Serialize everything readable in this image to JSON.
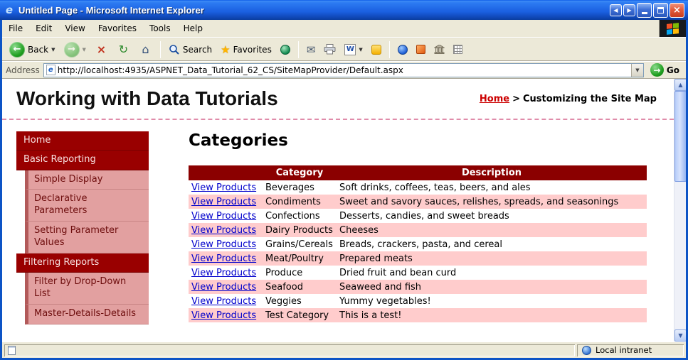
{
  "window": {
    "title": "Untitled Page - Microsoft Internet Explorer"
  },
  "menu": {
    "items": [
      {
        "label": "File"
      },
      {
        "label": "Edit"
      },
      {
        "label": "View"
      },
      {
        "label": "Favorites"
      },
      {
        "label": "Tools"
      },
      {
        "label": "Help"
      }
    ]
  },
  "toolbar": {
    "back_label": "Back",
    "search_label": "Search",
    "favorites_label": "Favorites"
  },
  "address": {
    "label": "Address",
    "value": "http://localhost:4935/ASPNET_Data_Tutorial_62_CS/SiteMapProvider/Default.aspx",
    "go_label": "Go"
  },
  "page": {
    "title": "Working with Data Tutorials",
    "breadcrumb": {
      "home_label": "Home",
      "separator": ">",
      "current": "Customizing the Site Map"
    },
    "sidebar": [
      {
        "label": "Home"
      },
      {
        "label": "Basic Reporting"
      },
      {
        "label": "Simple Display"
      },
      {
        "label": "Declarative Parameters"
      },
      {
        "label": "Setting Parameter Values"
      },
      {
        "label": "Filtering Reports"
      },
      {
        "label": "Filter by Drop-Down List"
      },
      {
        "label": "Master-Details-Details"
      }
    ],
    "main": {
      "heading": "Categories",
      "table": {
        "headers": {
          "category": "Category",
          "description": "Description"
        },
        "link_label": "View Products",
        "rows": [
          {
            "category": "Beverages",
            "description": "Soft drinks, coffees, teas, beers, and ales"
          },
          {
            "category": "Condiments",
            "description": "Sweet and savory sauces, relishes, spreads, and seasonings"
          },
          {
            "category": "Confections",
            "description": "Desserts, candies, and sweet breads"
          },
          {
            "category": "Dairy Products",
            "description": "Cheeses"
          },
          {
            "category": "Grains/Cereals",
            "description": "Breads, crackers, pasta, and cereal"
          },
          {
            "category": "Meat/Poultry",
            "description": "Prepared meats"
          },
          {
            "category": "Produce",
            "description": "Dried fruit and bean curd"
          },
          {
            "category": "Seafood",
            "description": "Seaweed and fish"
          },
          {
            "category": "Veggies",
            "description": "Yummy vegetables!"
          },
          {
            "category": "Test Category",
            "description": "This is a test!"
          }
        ]
      }
    }
  },
  "status": {
    "zone_label": "Local intranet"
  },
  "icons": {
    "ie_e": "e",
    "back": "←",
    "forward": "→",
    "dropdown": "▼",
    "stop": "×",
    "refresh": "↻",
    "home": "⌂",
    "favorites_star": "★",
    "mail": "✉",
    "word": "W",
    "go": "→",
    "scroll_up": "▲",
    "scroll_down": "▼",
    "tri_left": "◀",
    "tri_right": "▶",
    "close": "×"
  },
  "colors": {
    "titlebar_blue": "#1A5FE0",
    "maroon_header": "#8B0000",
    "maroon_sidebar": "#990000",
    "row_pink": "#FFCCCC",
    "sidebar_child_pink": "#E2A0A0",
    "link_blue": "#0000CC",
    "breadcrumb_red": "#CC0000",
    "chrome_tan": "#ECE9D8"
  }
}
